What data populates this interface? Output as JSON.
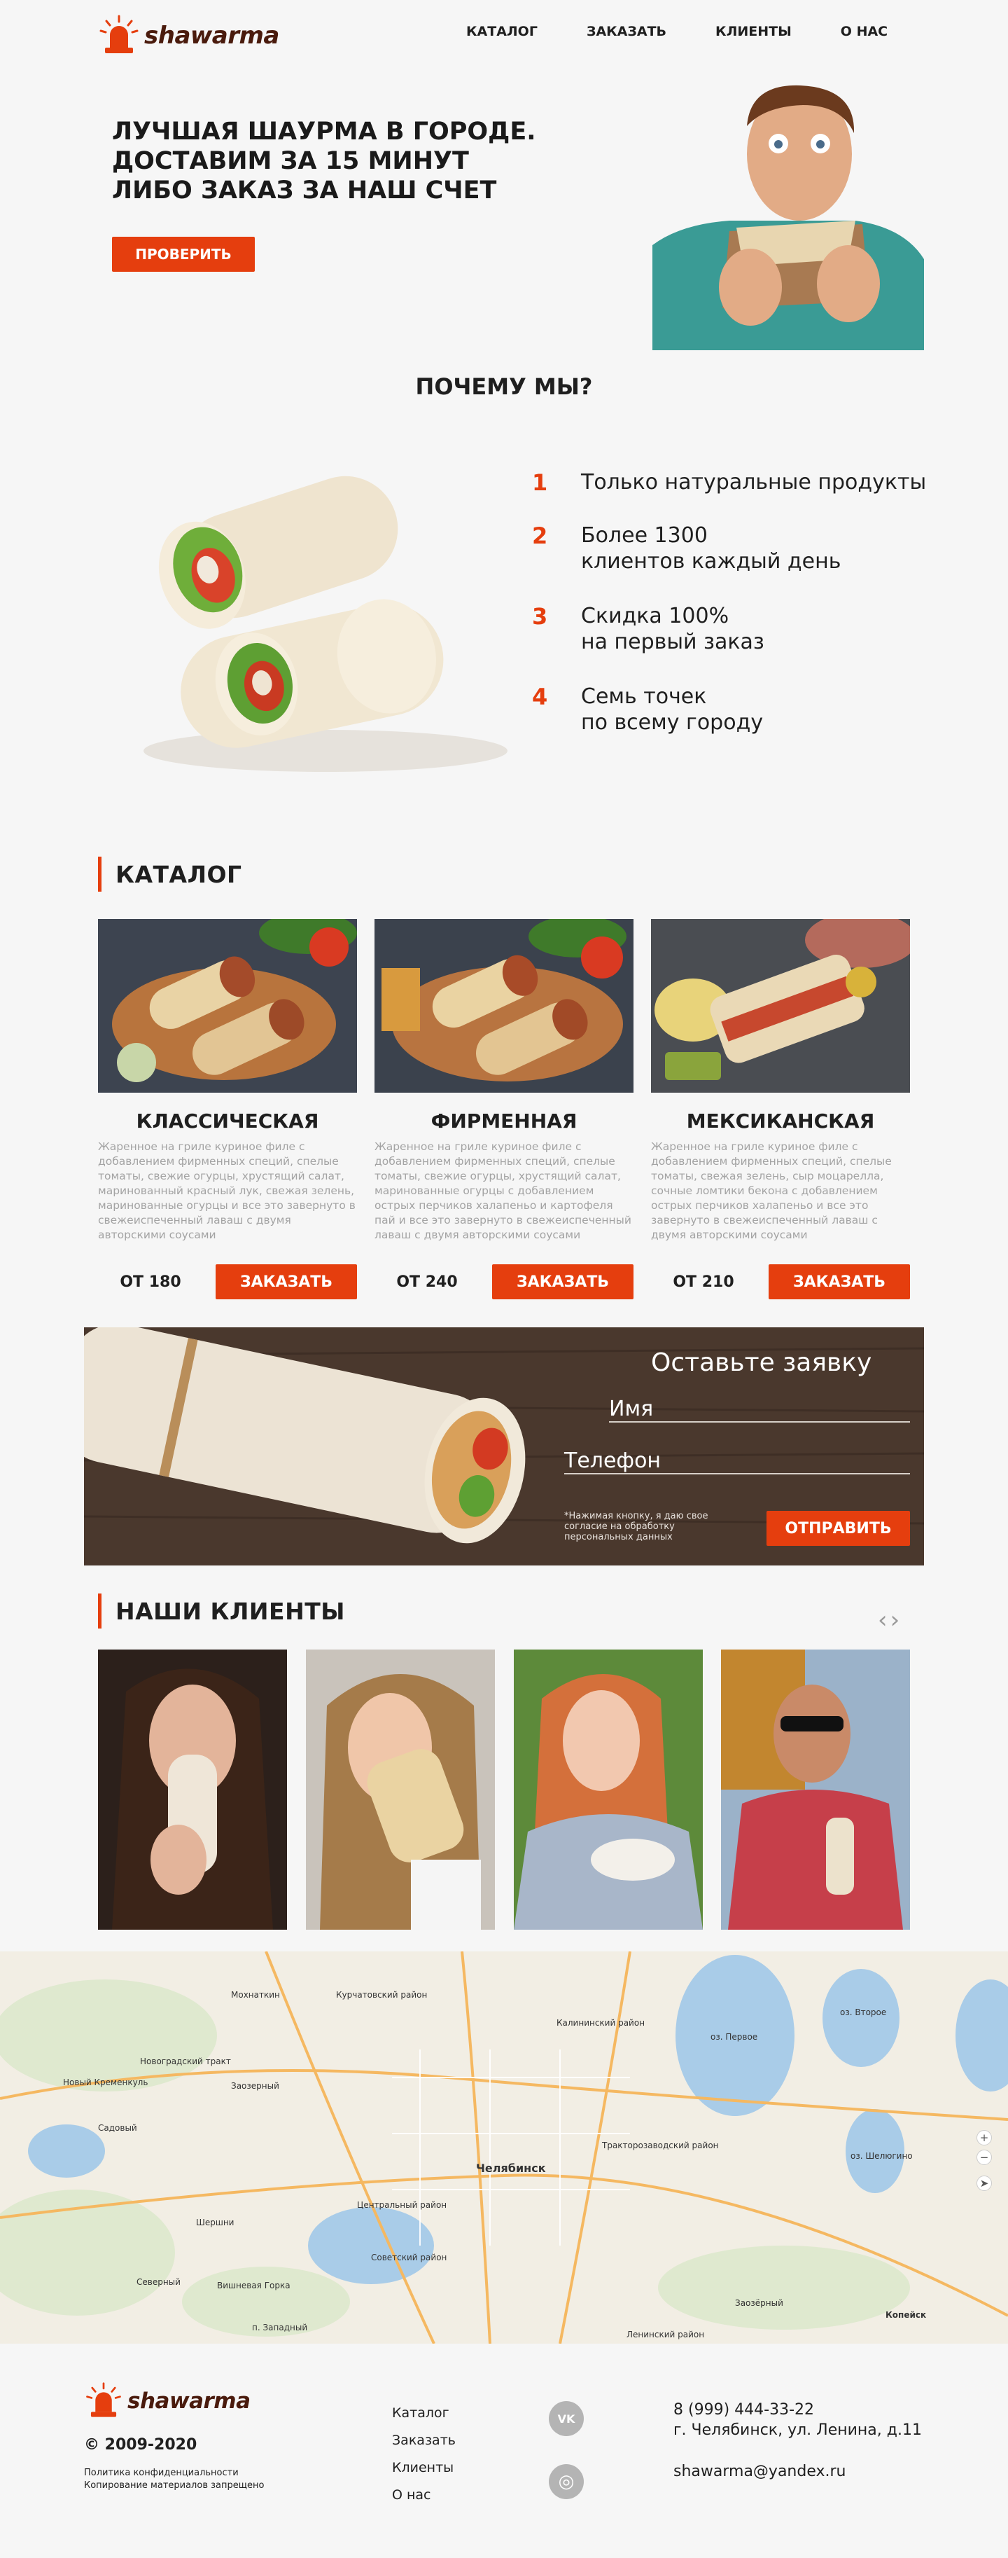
{
  "brand": {
    "name": "shawarma"
  },
  "nav": [
    {
      "label": "КАТАЛОГ"
    },
    {
      "label": "ЗАКАЗАТЬ"
    },
    {
      "label": "КЛИЕНТЫ"
    },
    {
      "label": "О НАС"
    }
  ],
  "hero": {
    "title_lines": [
      "ЛУЧШАЯ ШАУРМА В ГОРОДЕ.",
      "ДОСТАВИМ ЗА 15 МИНУТ",
      "ЛИБО ЗАКАЗ ЗА НАШ СЧЕТ"
    ],
    "button": "ПРОВЕРИТЬ"
  },
  "why": {
    "title": "ПОЧЕМУ МЫ?",
    "features": [
      {
        "num": "1",
        "lines": [
          "Только натуральные продукты"
        ]
      },
      {
        "num": "2",
        "lines": [
          "Более 1300",
          "клиентов каждый день"
        ]
      },
      {
        "num": "3",
        "lines": [
          "Скидка 100%",
          "на первый заказ"
        ]
      },
      {
        "num": "4",
        "lines": [
          "Семь точек",
          "по всему городу"
        ]
      }
    ]
  },
  "catalog": {
    "title": "КАТАЛОГ",
    "items": [
      {
        "name": "КЛАССИЧЕСКАЯ",
        "desc": "Жаренное на гриле куриное филе с добавлением фирменных специй, спелые томаты, свежие огурцы, хрустящий салат, маринованный красный лук, свежая зелень, маринованные огурцы и все это завернуто в свежеиспеченный лаваш с двумя авторскими соусами",
        "price": "ОТ 180",
        "button": "ЗАКАЗАТЬ"
      },
      {
        "name": "ФИРМЕННАЯ",
        "desc": "Жаренное на гриле куриное филе с добавлением фирменных специй, спелые томаты, свежие огурцы, хрустящий салат, маринованные огурцы с добавлением острых перчиков халапеньо и картофеля пай и все это завернуто в свежеиспеченный лаваш с двумя авторскими соусами",
        "price": "ОТ 240",
        "button": "ЗАКАЗАТЬ"
      },
      {
        "name": "МЕКСИКАНСКАЯ",
        "desc": "Жаренное на гриле куриное филе с добавлением фирменных специй, спелые томаты, свежая зелень, сыр моцарелла, сочные ломтики бекона с добавлением острых перчиков халапеньо и все это завернуто в свежеиспеченный лаваш с двумя авторскими соусами",
        "price": "ОТ 210",
        "button": "ЗАКАЗАТЬ"
      }
    ]
  },
  "order_form": {
    "title": "Оставьте заявку",
    "name_label": "Имя",
    "phone_label": "Телефон",
    "consent_lines": [
      "*Нажимая кнопку, я даю свое",
      "согласие на обработку",
      "персональных данных"
    ],
    "button": "ОТПРАВИТЬ"
  },
  "clients": {
    "title": "НАШИ КЛИЕНТЫ",
    "prev": "‹",
    "next": "›"
  },
  "map": {
    "labels": [
      "Мохнаткин",
      "Курчатовский район",
      "Калининский район",
      "Новый Кременкуль",
      "Новоградский тракт",
      "Заозерный",
      "Садовый",
      "п. Западный",
      "Челябинск",
      "Тракторозаводский район",
      "Центральный район",
      "Советский район",
      "Шершни",
      "Вишневая Горка",
      "Копейск",
      "оз. Первое",
      "оз. Шелюгино",
      "оз. Второе",
      "Северный",
      "Ленинский район",
      "Заозёрный"
    ],
    "zoom_in": "+",
    "zoom_out": "−"
  },
  "footer": {
    "brand": "shawarma",
    "copyright": "© 2009-2020",
    "legal_lines": [
      "Политика конфиденциальности",
      "Копирование материалов запрещено"
    ],
    "nav": [
      "Каталог",
      "Заказать",
      "Клиенты",
      "О нас"
    ],
    "social": [
      {
        "icon": "vk-icon",
        "label": "VK"
      },
      {
        "icon": "instagram-icon",
        "label": "◎"
      }
    ],
    "phone": "8 (999) 444-33-22",
    "address": "г. Челябинск, ул. Ленина, д.11",
    "email": "shawarma@yandex.ru"
  },
  "colors": {
    "accent": "#e53e0e",
    "brand_text": "#4a1b0d",
    "background": "#f6f6f6"
  }
}
